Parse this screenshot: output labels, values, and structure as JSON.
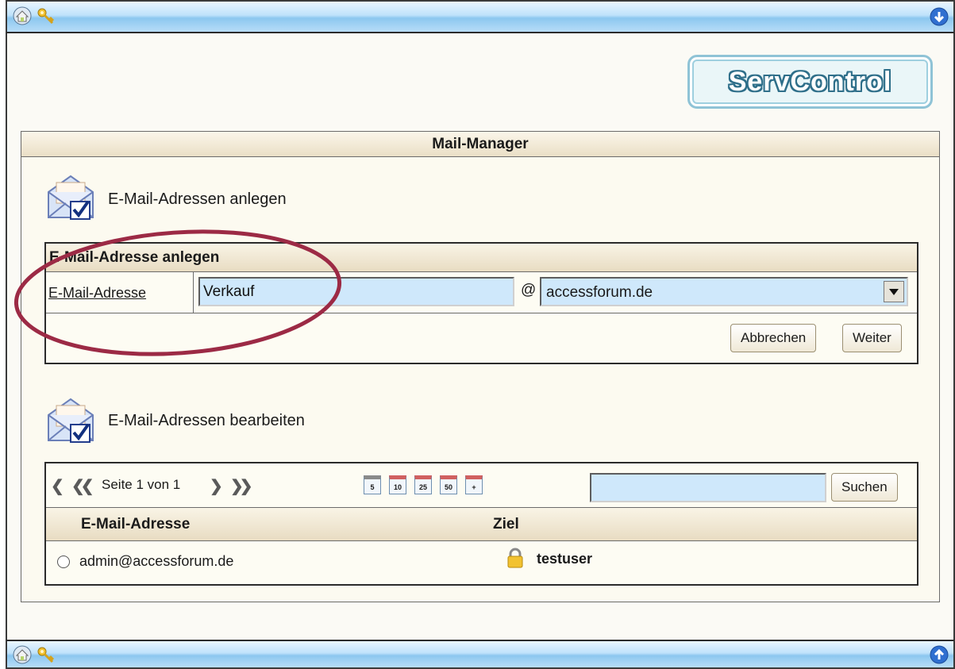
{
  "header": {
    "brand": "ServControl"
  },
  "panel": {
    "title": "Mail-Manager"
  },
  "create_section": {
    "title": "E-Mail-Adressen anlegen",
    "form_title": "E-Mail-Adresse anlegen",
    "field_label": "E-Mail-Adresse",
    "local_part_value": "Verkauf",
    "at": "@",
    "domain_selected": "accessforum.de",
    "cancel_label": "Abbrechen",
    "next_label": "Weiter"
  },
  "edit_section": {
    "title": "E-Mail-Adressen bearbeiten",
    "page_info": "Seite 1 von 1",
    "page_sizes": [
      "5",
      "10",
      "25",
      "50",
      "+"
    ],
    "search_value": "",
    "search_label": "Suchen",
    "columns": [
      "E-Mail-Adresse",
      "Ziel"
    ],
    "rows": [
      {
        "address": "admin@accessforum.de",
        "target": "testuser"
      }
    ]
  },
  "icons": [
    "home-icon",
    "key-icon",
    "scroll-down-icon",
    "scroll-up-icon",
    "envelope-check-icon",
    "lock-icon"
  ],
  "colors": {
    "bar_blue": "#8cc7ef",
    "field_blue": "#cfe8fb",
    "panel_header": "#eadfc6",
    "highlight_ellipse": "#9c2a45"
  }
}
